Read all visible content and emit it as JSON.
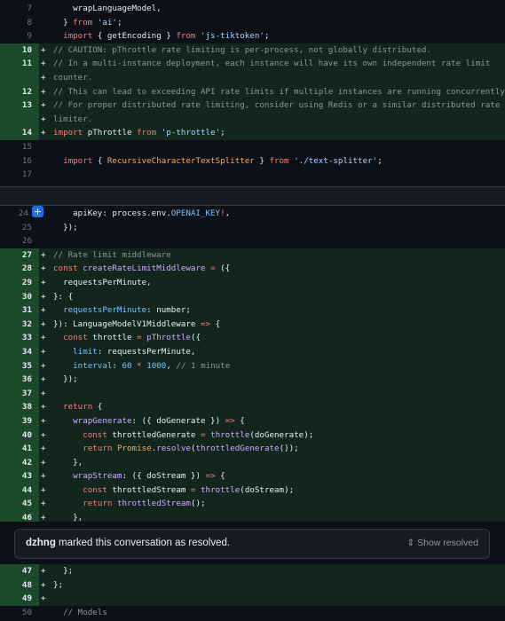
{
  "hunk1": [
    {
      "n": "7",
      "t": "ctx",
      "code": [
        [
          "",
          "    wrapLanguageModel,"
        ]
      ]
    },
    {
      "n": "8",
      "t": "ctx",
      "code": [
        [
          "",
          "  } "
        ],
        [
          "k",
          "from"
        ],
        [
          "",
          " "
        ],
        [
          "s",
          "'ai'"
        ],
        [
          "",
          ";"
        ]
      ]
    },
    {
      "n": "9",
      "t": "ctx",
      "code": [
        [
          "",
          "  "
        ],
        [
          "k",
          "import"
        ],
        [
          "",
          " { getEncoding } "
        ],
        [
          "k",
          "from"
        ],
        [
          "",
          " "
        ],
        [
          "s",
          "'js-tiktoken'"
        ],
        [
          "",
          ";"
        ]
      ]
    },
    {
      "n": "10",
      "t": "add",
      "code": [
        [
          "c",
          "// CAUTION: pThrottle rate limiting is per-process, not globally distributed."
        ]
      ]
    },
    {
      "n": "11",
      "t": "add",
      "code": [
        [
          "c",
          "// In a multi-instance deployment, each instance will have its own independent rate limit"
        ]
      ]
    },
    {
      "n": "",
      "t": "add",
      "code": [
        [
          "c",
          "counter."
        ]
      ]
    },
    {
      "n": "12",
      "t": "add",
      "code": [
        [
          "c",
          "// This can lead to exceeding API rate limits if multiple instances are running concurrently."
        ]
      ]
    },
    {
      "n": "13",
      "t": "add",
      "code": [
        [
          "c",
          "// For proper distributed rate limiting, consider using Redis or a similar distributed rate"
        ]
      ]
    },
    {
      "n": "",
      "t": "add",
      "code": [
        [
          "c",
          "limiter."
        ]
      ]
    },
    {
      "n": "14",
      "t": "add",
      "code": [
        [
          "k",
          "import"
        ],
        [
          "",
          " pThrottle "
        ],
        [
          "k",
          "from"
        ],
        [
          "",
          " "
        ],
        [
          "s",
          "'p-throttle'"
        ],
        [
          "",
          ";"
        ]
      ]
    },
    {
      "n": "15",
      "t": "ctx",
      "code": [
        [
          "",
          ""
        ]
      ]
    },
    {
      "n": "16",
      "t": "ctx",
      "code": [
        [
          "",
          "  "
        ],
        [
          "k",
          "import"
        ],
        [
          "",
          " { "
        ],
        [
          "v",
          "RecursiveCharacterTextSplitter"
        ],
        [
          "",
          " } "
        ],
        [
          "k",
          "from"
        ],
        [
          "",
          " "
        ],
        [
          "s",
          "'./text-splitter'"
        ],
        [
          "",
          ";"
        ]
      ]
    },
    {
      "n": "17",
      "t": "ctx",
      "code": [
        [
          "",
          ""
        ]
      ]
    }
  ],
  "hunk2": [
    {
      "n": "24",
      "t": "ctx",
      "code": [
        [
          "",
          "    apiKey: process.env."
        ],
        [
          "n",
          "OPENAI_KEY"
        ],
        [
          "k",
          "!"
        ],
        [
          "",
          ","
        ]
      ]
    },
    {
      "n": "25",
      "t": "ctx",
      "code": [
        [
          "",
          "  });"
        ]
      ]
    },
    {
      "n": "26",
      "t": "ctx",
      "code": [
        [
          "",
          ""
        ]
      ]
    },
    {
      "n": "27",
      "t": "add",
      "code": [
        [
          "c",
          "// Rate limit middleware"
        ]
      ]
    },
    {
      "n": "28",
      "t": "add",
      "code": [
        [
          "k",
          "const"
        ],
        [
          "",
          " "
        ],
        [
          "f",
          "createRateLimitMiddleware"
        ],
        [
          "",
          " "
        ],
        [
          "k",
          "="
        ],
        [
          "",
          " ({"
        ]
      ]
    },
    {
      "n": "29",
      "t": "add",
      "code": [
        [
          "",
          "  requestsPerMinute,"
        ]
      ]
    },
    {
      "n": "30",
      "t": "add",
      "code": [
        [
          "",
          "}: {"
        ]
      ]
    },
    {
      "n": "31",
      "t": "add",
      "code": [
        [
          "",
          "  "
        ],
        [
          "n",
          "requestsPerMinute"
        ],
        [
          "",
          ": number;"
        ]
      ]
    },
    {
      "n": "32",
      "t": "add",
      "code": [
        [
          "",
          "}): LanguageModelV1Middleware "
        ],
        [
          "k",
          "=>"
        ],
        [
          "",
          " {"
        ]
      ]
    },
    {
      "n": "33",
      "t": "add",
      "code": [
        [
          "",
          "  "
        ],
        [
          "k",
          "const"
        ],
        [
          "",
          " throttle "
        ],
        [
          "k",
          "="
        ],
        [
          "",
          " "
        ],
        [
          "f",
          "pThrottle"
        ],
        [
          "",
          "({"
        ]
      ]
    },
    {
      "n": "34",
      "t": "add",
      "code": [
        [
          "",
          "    "
        ],
        [
          "n",
          "limit"
        ],
        [
          "",
          ": requestsPerMinute,"
        ]
      ]
    },
    {
      "n": "35",
      "t": "add",
      "code": [
        [
          "",
          "    "
        ],
        [
          "n",
          "interval"
        ],
        [
          "",
          ": "
        ],
        [
          "n",
          "60"
        ],
        [
          "",
          " "
        ],
        [
          "k",
          "*"
        ],
        [
          "",
          " "
        ],
        [
          "n",
          "1000"
        ],
        [
          "",
          ", "
        ],
        [
          "c",
          "// 1 minute"
        ]
      ]
    },
    {
      "n": "36",
      "t": "add",
      "code": [
        [
          "",
          "  });"
        ]
      ]
    },
    {
      "n": "37",
      "t": "add",
      "code": [
        [
          "",
          ""
        ]
      ]
    },
    {
      "n": "38",
      "t": "add",
      "code": [
        [
          "",
          "  "
        ],
        [
          "k",
          "return"
        ],
        [
          "",
          " {"
        ]
      ]
    },
    {
      "n": "39",
      "t": "add",
      "code": [
        [
          "",
          "    "
        ],
        [
          "f",
          "wrapGenerate"
        ],
        [
          "",
          ": ({ doGenerate }) "
        ],
        [
          "k",
          "=>"
        ],
        [
          "",
          " {"
        ]
      ]
    },
    {
      "n": "40",
      "t": "add",
      "code": [
        [
          "",
          "      "
        ],
        [
          "k",
          "const"
        ],
        [
          "",
          " throttledGenerate "
        ],
        [
          "k",
          "="
        ],
        [
          "",
          " "
        ],
        [
          "f",
          "throttle"
        ],
        [
          "",
          "(doGenerate);"
        ]
      ]
    },
    {
      "n": "41",
      "t": "add",
      "code": [
        [
          "",
          "      "
        ],
        [
          "k",
          "return"
        ],
        [
          "",
          " "
        ],
        [
          "v",
          "Promise"
        ],
        [
          "",
          "."
        ],
        [
          "f",
          "resolve"
        ],
        [
          "",
          "("
        ],
        [
          "f",
          "throttledGenerate"
        ],
        [
          "",
          "());"
        ]
      ]
    },
    {
      "n": "42",
      "t": "add",
      "code": [
        [
          "",
          "    },"
        ]
      ]
    },
    {
      "n": "43",
      "t": "add",
      "code": [
        [
          "",
          "    "
        ],
        [
          "f",
          "wrapStream"
        ],
        [
          "",
          ": ({ doStream }) "
        ],
        [
          "k",
          "=>"
        ],
        [
          "",
          " {"
        ]
      ]
    },
    {
      "n": "44",
      "t": "add",
      "code": [
        [
          "",
          "      "
        ],
        [
          "k",
          "const"
        ],
        [
          "",
          " throttledStream "
        ],
        [
          "k",
          "="
        ],
        [
          "",
          " "
        ],
        [
          "f",
          "throttle"
        ],
        [
          "",
          "(doStream);"
        ]
      ]
    },
    {
      "n": "45",
      "t": "add",
      "code": [
        [
          "",
          "      "
        ],
        [
          "k",
          "return"
        ],
        [
          "",
          " "
        ],
        [
          "f",
          "throttledStream"
        ],
        [
          "",
          "();"
        ]
      ]
    },
    {
      "n": "46",
      "t": "add",
      "code": [
        [
          "",
          "    },"
        ]
      ]
    }
  ],
  "resolved": {
    "user": "dzhng",
    "text": " marked this conversation as resolved.",
    "show": "Show resolved"
  },
  "hunk3": [
    {
      "n": "47",
      "t": "add",
      "code": [
        [
          "",
          "  };"
        ]
      ]
    },
    {
      "n": "48",
      "t": "add",
      "code": [
        [
          "",
          "};"
        ]
      ]
    },
    {
      "n": "49",
      "t": "add",
      "code": [
        [
          "",
          ""
        ]
      ]
    },
    {
      "n": "50",
      "t": "ctx",
      "code": [
        [
          "",
          "  "
        ],
        [
          "c",
          "// Models"
        ]
      ]
    }
  ],
  "expand_icon": "plus-icon"
}
